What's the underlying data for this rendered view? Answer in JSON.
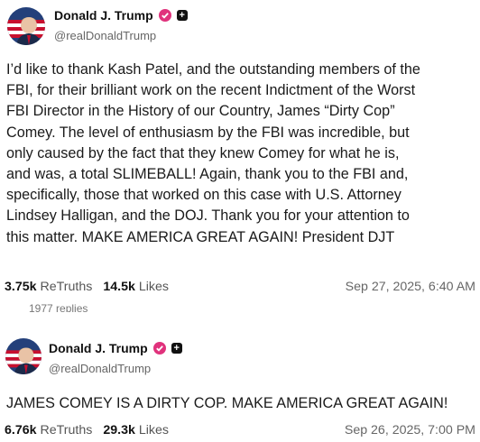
{
  "posts": [
    {
      "author": {
        "name": "Donald J. Trump",
        "handle": "@realDonaldTrump",
        "avatar_icon": "avatar-portrait-flag",
        "verified_color": "#e0327c"
      },
      "lines": [
        "I’d like to thank Kash Patel, and the outstanding members of the",
        "FBI, for their brilliant work on the recent Indictment of the Worst",
        "FBI Director in the History of our Country, James “Dirty Cop”",
        "Comey. The level of enthusiasm by the FBI was incredible, but",
        "only caused by the fact that they knew Comey for what he is,",
        "and was, a total SLIMEBALL! Again, thank you to the FBI and,",
        "specifically, those that worked on this case with U.S. Attorney",
        "Lindsey Halligan, and the DOJ. Thank you for your attention to",
        "this matter. MAKE AMERICA GREAT AGAIN! President DJT"
      ],
      "retruths_count": "3.75k",
      "retruths_label": "ReTruths",
      "likes_count": "14.5k",
      "likes_label": "Likes",
      "timestamp": "Sep 27, 2025, 6:40 AM",
      "replies": "1977 replies"
    },
    {
      "author": {
        "name": "Donald J. Trump",
        "handle": "@realDonaldTrump",
        "avatar_icon": "avatar-portrait-flag",
        "verified_color": "#e0327c"
      },
      "lines": [
        "JAMES COMEY IS A DIRTY COP. MAKE AMERICA GREAT AGAIN!"
      ],
      "retruths_count": "6.76k",
      "retruths_label": "ReTruths",
      "likes_count": "29.3k",
      "likes_label": "Likes",
      "timestamp": "Sep 26, 2025, 7:00 PM"
    }
  ]
}
